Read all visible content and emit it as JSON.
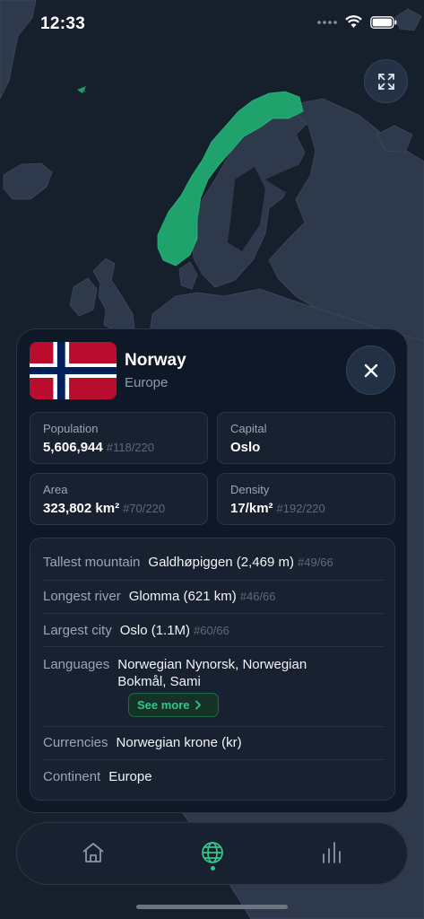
{
  "status_bar": {
    "time": "12:33"
  },
  "country": {
    "name": "Norway",
    "continent": "Europe",
    "flag_colors": {
      "red": "#BA0C2F",
      "white": "#FFFFFF",
      "blue": "#00205B"
    }
  },
  "stats": {
    "population": {
      "label": "Population",
      "value": "5,606,944",
      "rank": "#118/220"
    },
    "capital": {
      "label": "Capital",
      "value": "Oslo"
    },
    "area": {
      "label": "Area",
      "value": "323,802 km²",
      "rank": "#70/220"
    },
    "density": {
      "label": "Density",
      "value": "17/km²",
      "rank": "#192/220"
    }
  },
  "details": {
    "tallest_mountain": {
      "label": "Tallest mountain",
      "value": "Galdhøpiggen (2,469 m)",
      "rank": "#49/66"
    },
    "longest_river": {
      "label": "Longest river",
      "value": "Glomma (621 km)",
      "rank": "#46/66"
    },
    "largest_city": {
      "label": "Largest city",
      "value": "Oslo (1.1M)",
      "rank": "#60/66"
    },
    "languages": {
      "label": "Languages",
      "value": "Norwegian Nynorsk, Norwegian Bokmål, Sami",
      "see_more": "See more"
    },
    "currencies": {
      "label": "Currencies",
      "value": "Norwegian krone (kr)"
    },
    "continent": {
      "label": "Continent",
      "value": "Europe"
    }
  },
  "tabbar": {
    "items": [
      {
        "icon": "home-icon",
        "active": false
      },
      {
        "icon": "globe-icon",
        "active": true
      },
      {
        "icon": "bar-chart-icon",
        "active": false
      }
    ]
  },
  "colors": {
    "background": "#161f2c",
    "land": "#2e3a4c",
    "highlight": "#1fa26c",
    "accent": "#35c58a",
    "card": "#0f1826"
  }
}
